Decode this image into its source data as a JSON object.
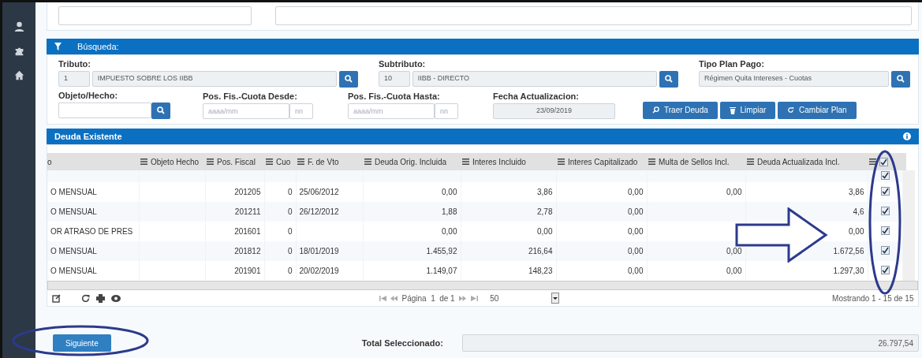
{
  "search_panel": {
    "title": "Búsqueda:",
    "tributo": {
      "label": "Tributo:",
      "code": "1",
      "value": "IMPUESTO SOBRE LOS IIBB"
    },
    "subtributo": {
      "label": "Subtributo:",
      "code": "10",
      "value": "IIBB - DIRECTO"
    },
    "tipo_plan": {
      "label": "Tipo Plan Pago:",
      "value": "Régimen Quita Intereses - Cuotas"
    },
    "objeto": {
      "label": "Objeto/Hecho:"
    },
    "desde": {
      "label": "Pos. Fis.-Cuota Desde:",
      "placeholder": "aaaa/mm",
      "placeholder_cuota": "nn"
    },
    "hasta": {
      "label": "Pos. Fis.-Cuota Hasta:",
      "placeholder": "aaaa/mm",
      "placeholder_cuota": "nn"
    },
    "fecha": {
      "label": "Fecha Actualizacion:",
      "value": "23/09/2019"
    },
    "buttons": [
      {
        "label": "Traer Deuda",
        "kind": "search"
      },
      {
        "label": "Limpiar",
        "kind": "trash"
      },
      {
        "label": "Cambiar Plan",
        "kind": "refresh"
      }
    ]
  },
  "grid": {
    "title": "Deuda Existente",
    "select_all_checked": true,
    "columns": [
      "o",
      "Objeto Hecho",
      "Pos. Fiscal",
      "Cuo",
      "F. de Vto",
      "Deuda Orig. Incluida",
      "Interes Incluido",
      "Interes Capitalizado",
      "Multa de Sellos Incl.",
      "Deuda Actualizada Incl."
    ],
    "rows": [
      {
        "checked": true
      },
      {
        "checked": true,
        "cells": [
          "O MENSUAL",
          null,
          "201205",
          "0",
          "25/06/2012",
          "0,00",
          "3,86",
          "0,00",
          "0,00",
          "3,86"
        ]
      },
      {
        "checked": true,
        "cells": [
          "O MENSUAL",
          null,
          "201211",
          "0",
          "26/12/2012",
          "1,88",
          "2,78",
          "0,00",
          null,
          "4,6"
        ]
      },
      {
        "checked": true,
        "cells": [
          "OR ATRASO DE PRES",
          null,
          "201601",
          "0",
          null,
          "0,00",
          "0,00",
          "0,00",
          null,
          "0,00"
        ]
      },
      {
        "checked": true,
        "cells": [
          "O MENSUAL",
          null,
          "201812",
          "0",
          "18/01/2019",
          "1.455,92",
          "216,64",
          "0,00",
          "0,00",
          "1.672,56"
        ]
      },
      {
        "checked": true,
        "cells": [
          "O MENSUAL",
          null,
          "201901",
          "0",
          "20/02/2019",
          "1.149,07",
          "148,23",
          "0,00",
          "0,00",
          "1.297,30"
        ]
      }
    ]
  },
  "pager": {
    "page_label": "Página",
    "page": "1",
    "of": "de 1",
    "page_size": "50",
    "summary": "Mostrando 1 - 15 de 15"
  },
  "footer": {
    "next_button": "Siguiente",
    "total_label": "Total Seleccionado:",
    "total": "26.797,54"
  }
}
